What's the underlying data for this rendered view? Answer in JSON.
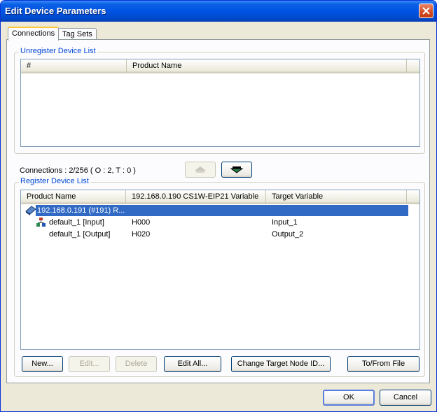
{
  "window": {
    "title": "Edit Device Parameters"
  },
  "tabs": [
    {
      "label": "Connections",
      "active": true
    },
    {
      "label": "Tag Sets",
      "active": false
    }
  ],
  "unregister": {
    "group_label": "Unregister Device List",
    "columns": [
      "#",
      "Product Name"
    ]
  },
  "connections_status": "Connections :   2/256 ( O : 2, T : 0 )",
  "arrow_buttons": {
    "up_icon": "move-up-icon",
    "down_icon": "move-down-icon"
  },
  "register": {
    "group_label": "Register Device List",
    "columns": [
      "Product Name",
      "192.168.0.190 CS1W-EIP21 Variable",
      "Target Variable"
    ],
    "device": {
      "label": "192.168.0.191 (#191) R...",
      "selected": true
    },
    "connections": [
      {
        "name": "default_1 [Input]",
        "variable": "H000",
        "target": "Input_1"
      },
      {
        "name": "default_1 [Output]",
        "variable": "H020",
        "target": "Output_2"
      }
    ]
  },
  "buttons": {
    "new": "New...",
    "edit": "Edit...",
    "delete": "Delete",
    "edit_all": "Edit All...",
    "change_target": "Change Target Node ID...",
    "to_from_file": "To/From File",
    "ok": "OK",
    "cancel": "Cancel"
  },
  "colors": {
    "titlebar": "#0054e3",
    "selection": "#316ac5",
    "group_label": "#0046d5"
  }
}
